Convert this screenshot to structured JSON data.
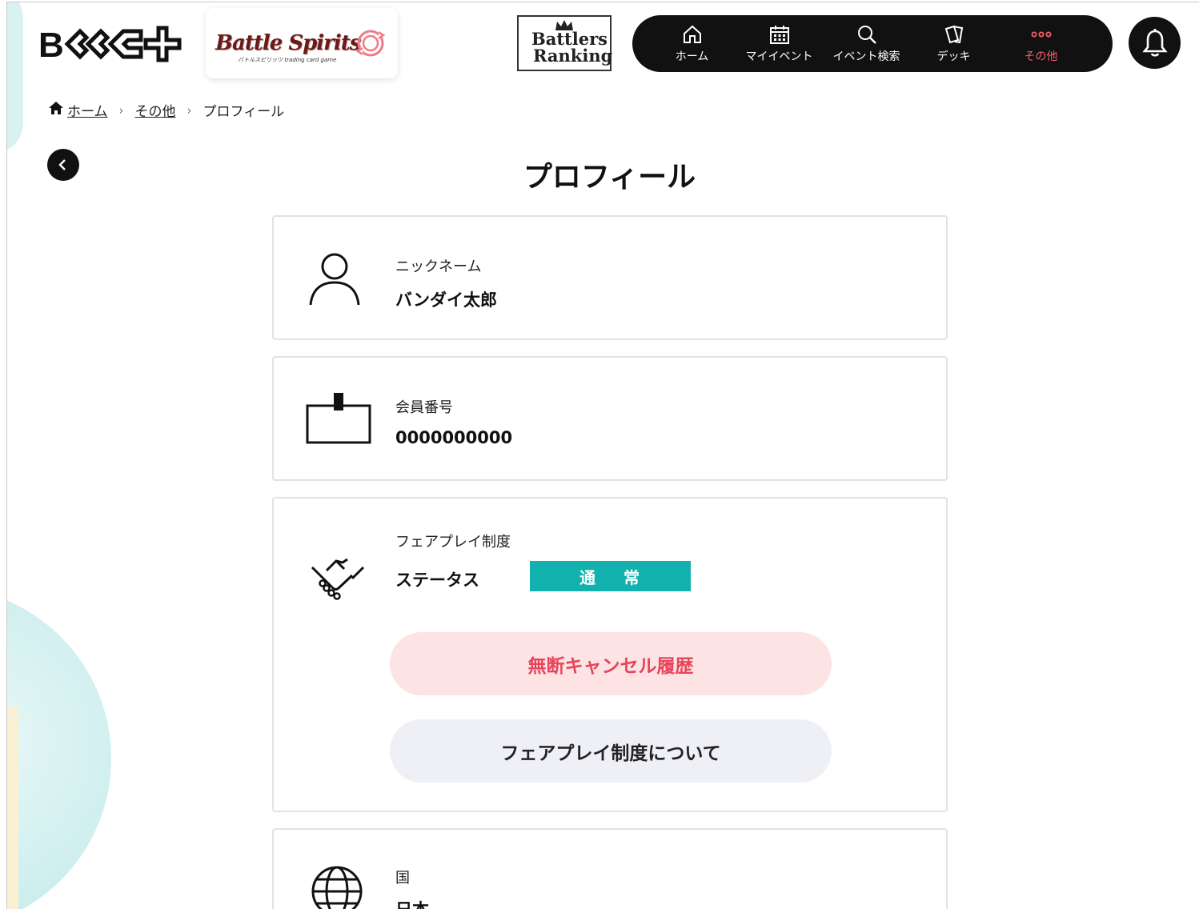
{
  "header": {
    "logo_text": "BCG+",
    "game_logo": "Battle Spirits",
    "game_logo_sub": "バトルスピリッツ trading card game",
    "ranking_logo_line1": "Battlers",
    "ranking_logo_line2": "Ranking",
    "nav": [
      {
        "label": "ホーム",
        "icon": "home-icon"
      },
      {
        "label": "マイイベント",
        "icon": "calendar-icon"
      },
      {
        "label": "イベント検索",
        "icon": "search-icon"
      },
      {
        "label": "デッキ",
        "icon": "cards-icon"
      },
      {
        "label": "その他",
        "icon": "more-icon",
        "active": true
      }
    ]
  },
  "breadcrumb": {
    "home": "ホーム",
    "other": "その他",
    "current": "プロフィール"
  },
  "page": {
    "title": "プロフィール"
  },
  "profile": {
    "nickname_label": "ニックネーム",
    "nickname_value": "バンダイ太郎",
    "member_label": "会員番号",
    "member_value": "0000000000",
    "fairplay_label": "フェアプレイ制度",
    "status_label": "ステータス",
    "status_value": "通 常",
    "cancel_history_button": "無断キャンセル履歴",
    "about_fairplay_button": "フェアプレイ制度について",
    "country_label": "国",
    "country_value": "日本"
  },
  "colors": {
    "accent_red": "#e8445a",
    "status_teal": "#13b1ad",
    "nav_bg": "#111111"
  }
}
